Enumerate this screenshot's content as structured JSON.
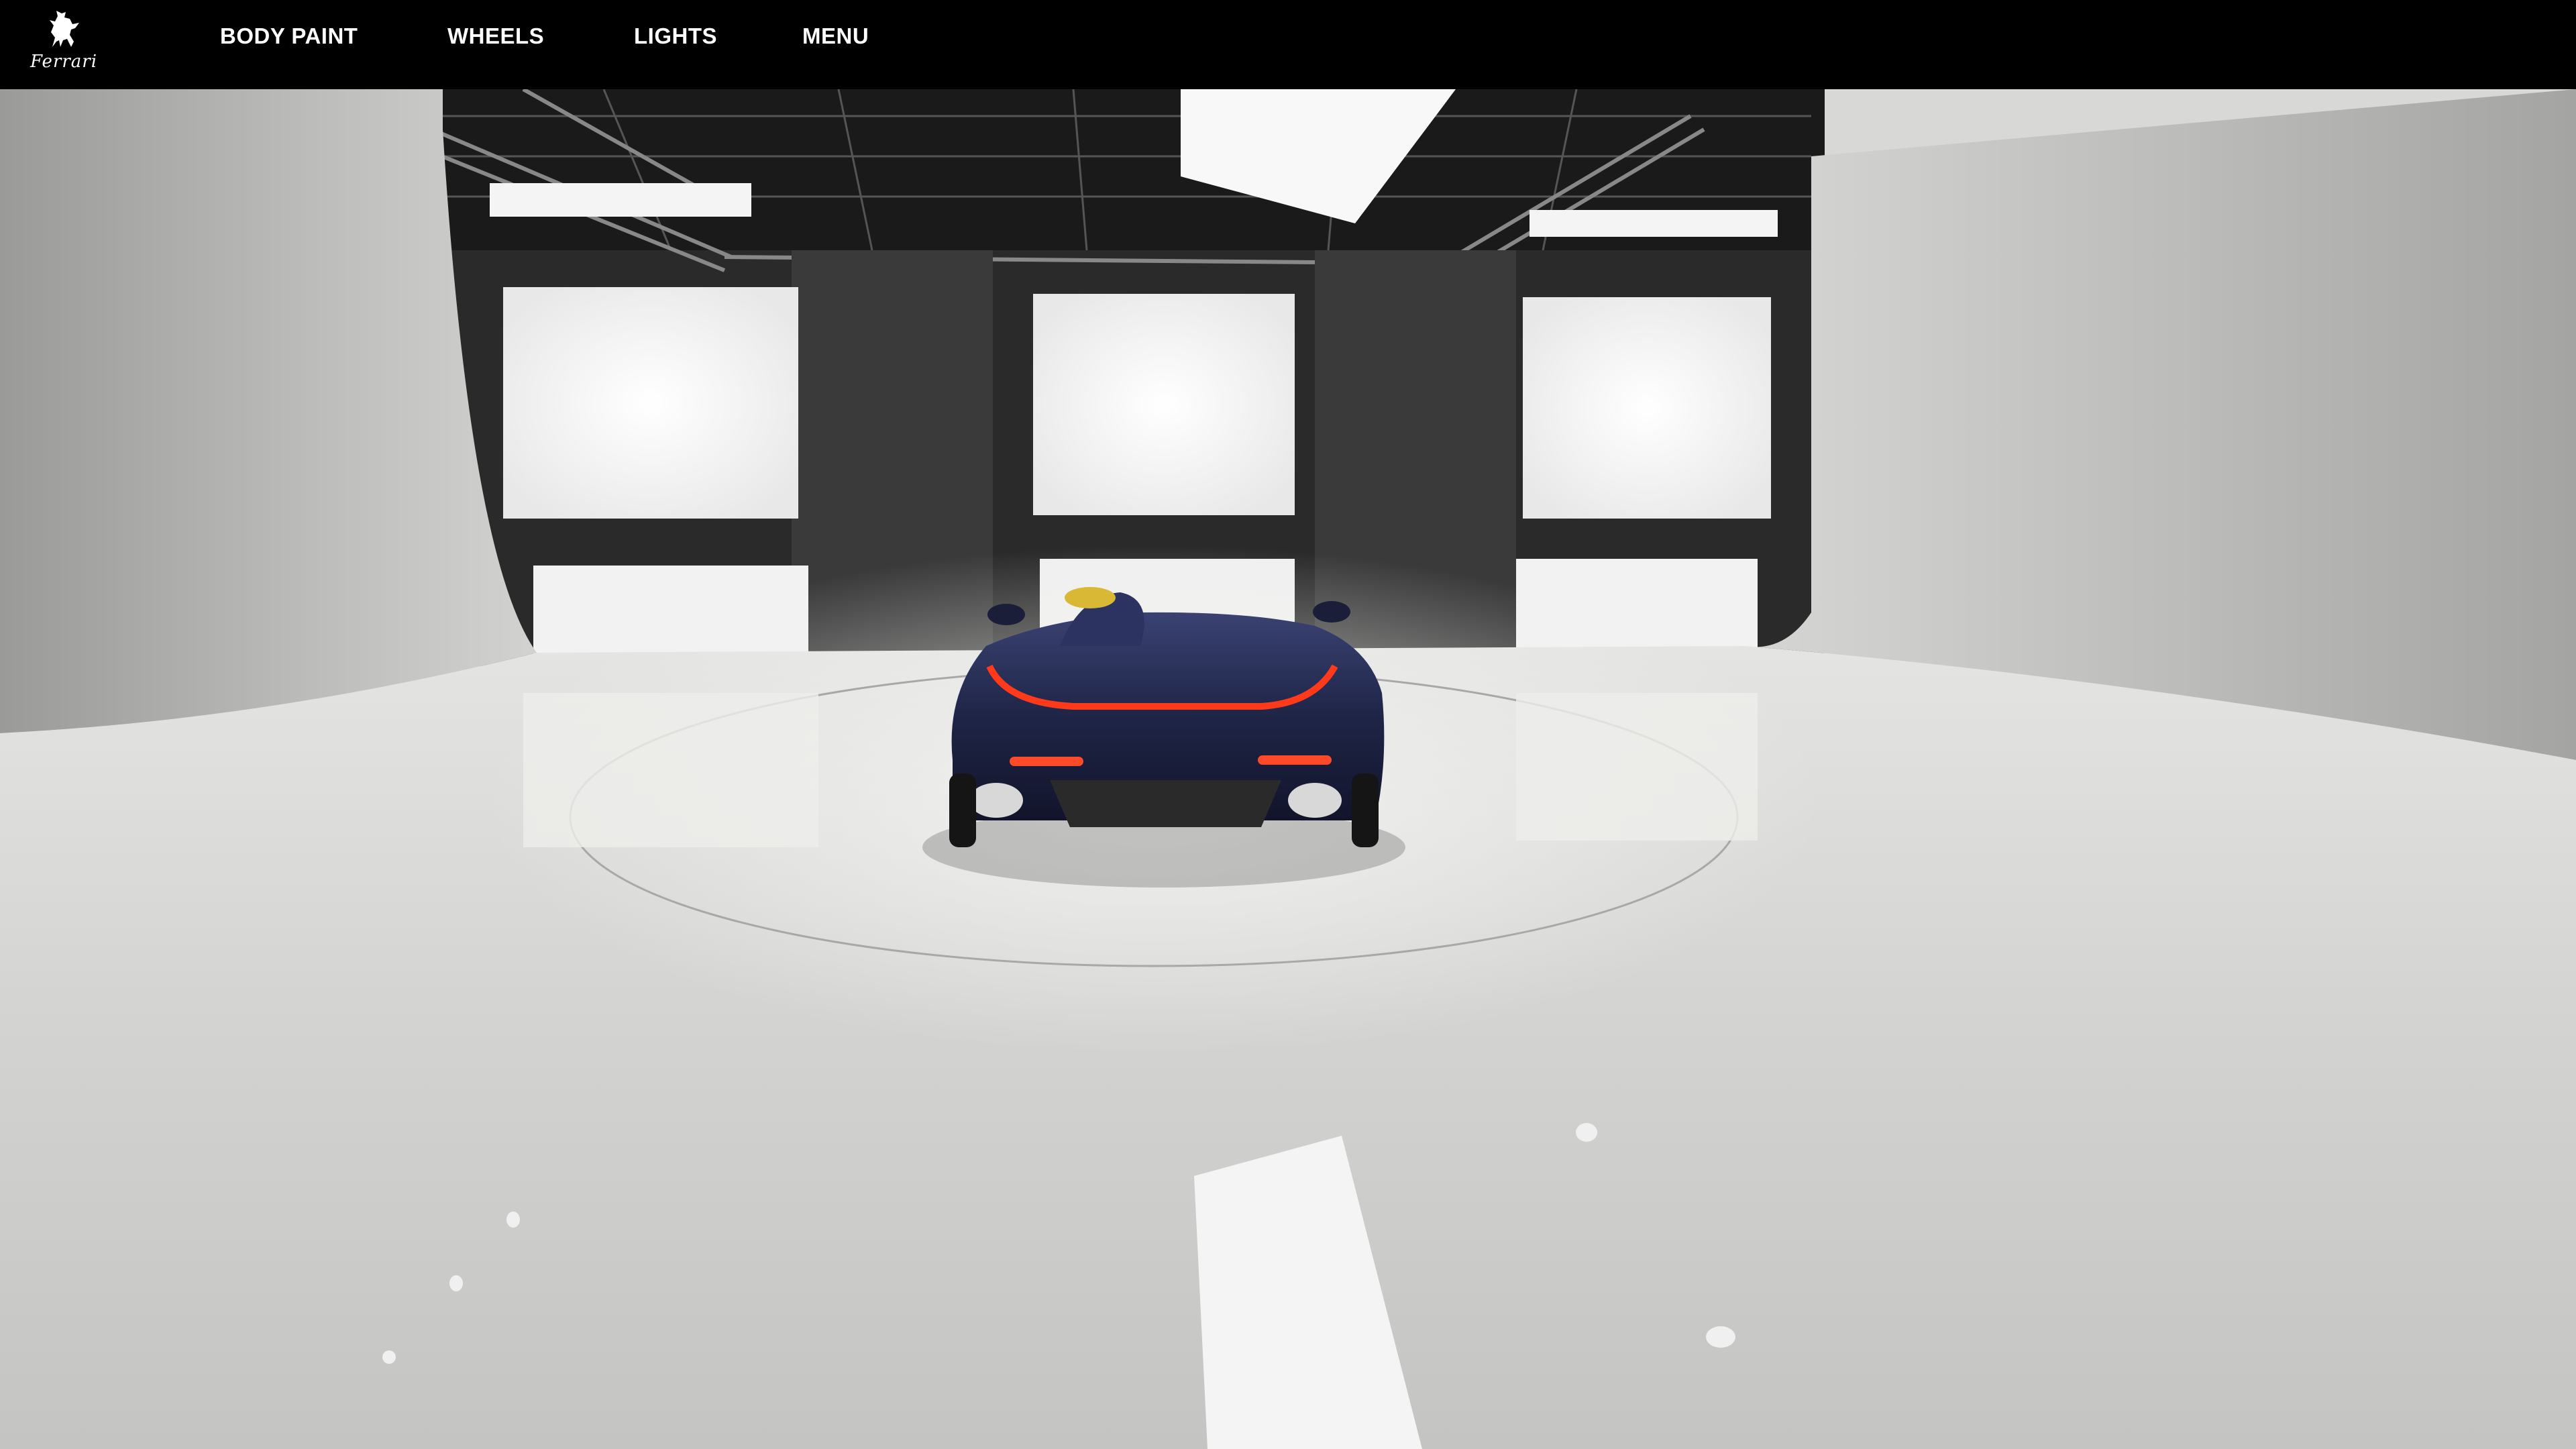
{
  "brand": {
    "name": "Ferrari",
    "logo_icon": "prancing-horse-icon"
  },
  "nav": {
    "items": [
      {
        "id": "body-paint",
        "label": "BODY PAINT"
      },
      {
        "id": "wheels",
        "label": "WHEELS"
      },
      {
        "id": "lights",
        "label": "LIGHTS"
      },
      {
        "id": "menu",
        "label": "MENU"
      }
    ]
  },
  "colors": {
    "navbar": "#000000",
    "nav_text": "#ffffff",
    "car_body": "#1f2547",
    "tail_light": "#ff3a1a",
    "studio_floor": "#d6d6d4"
  }
}
